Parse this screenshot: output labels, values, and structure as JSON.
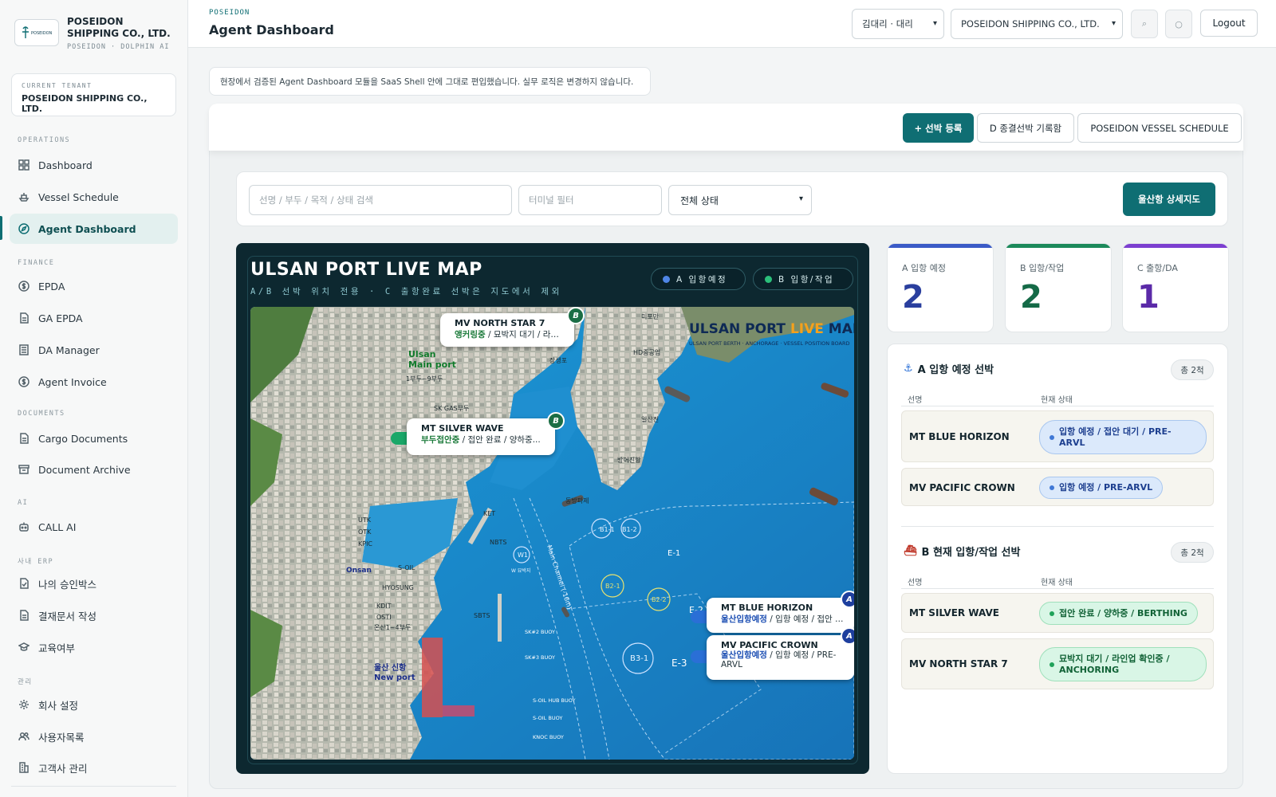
{
  "brand": {
    "name": "POSEIDON SHIPPING CO., LTD.",
    "sub": "POSEIDON · DOLPHIN AI",
    "logo_text": "POSEIDON"
  },
  "tenant": {
    "label": "CURRENT TENANT",
    "name": "POSEIDON SHIPPING CO., LTD."
  },
  "nav": {
    "operations_label": "OPERATIONS",
    "finance_label": "FINANCE",
    "documents_label": "DOCUMENTS",
    "ai_label": "AI",
    "erp_label": "사내 ERP",
    "admin_label": "관리",
    "items": [
      {
        "label": "Dashboard",
        "icon": "grid-icon"
      },
      {
        "label": "Vessel Schedule",
        "icon": "ship-icon"
      },
      {
        "label": "Agent Dashboard",
        "icon": "compass-icon",
        "active": true
      },
      {
        "label": "EPDA",
        "icon": "dollar-icon"
      },
      {
        "label": "GA EPDA",
        "icon": "document-icon"
      },
      {
        "label": "DA Manager",
        "icon": "document-list-icon"
      },
      {
        "label": "Agent Invoice",
        "icon": "dollar-icon"
      },
      {
        "label": "Cargo Documents",
        "icon": "document-icon"
      },
      {
        "label": "Document Archive",
        "icon": "archive-icon"
      },
      {
        "label": "CALL AI",
        "icon": "robot-icon"
      },
      {
        "label": "나의 승인박스",
        "icon": "check-document-icon"
      },
      {
        "label": "결재문서 작성",
        "icon": "document-icon"
      },
      {
        "label": "교육여부",
        "icon": "graduation-cap-icon"
      },
      {
        "label": "회사 설정",
        "icon": "gear-icon"
      },
      {
        "label": "사용자목록",
        "icon": "users-icon"
      },
      {
        "label": "고객사 관리",
        "icon": "building-icon"
      }
    ]
  },
  "header": {
    "crumb": "POSEIDON",
    "title": "Agent Dashboard",
    "user_select": "김대리 · 대리",
    "company_select": "POSEIDON SHIPPING CO., LTD.",
    "search_icon_glyph": "⌕",
    "user_icon_glyph": "○",
    "logout": "Logout"
  },
  "notice": "현장에서 검증된 Agent Dashboard 모듈을 SaaS Shell 안에 그대로 편입했습니다. 실무 로직은 변경하지 않습니다.",
  "toolbar": {
    "add_vessel": "+ 선박 등록",
    "closed_records": "D 종결선박 기록함",
    "schedule": "POSEIDON VESSEL SCHEDULE"
  },
  "filters": {
    "search_placeholder": "선명 / 부두 / 목적 / 상태 검색",
    "terminal_placeholder": "터미널 필터",
    "status_select": "전체 상태",
    "detail_map": "울산항 상세지도"
  },
  "map": {
    "title": "ULSAN PORT LIVE MAP",
    "subtitle": "A/B 선박 위치 전용 · C 출항완료 선박은 지도에서 제외",
    "legend_a": "A 입항예정",
    "legend_b": "B 입항/작업",
    "board_title_a": "ULSAN PORT ",
    "board_title_b": "LIVE",
    "board_title_c": " MAP",
    "board_sub": "ULSAN PORT BERTH · ANCHORAGE · VESSEL POSITION BOARD",
    "colors": {
      "a": "#4f86e6",
      "b": "#2bbf7a",
      "sea": "#1f8fd0"
    },
    "labels": {
      "ulsan_main": "Ulsan\nMain port",
      "main_berth": "1부두~9부두",
      "new_port": "울산 신항\nNew port",
      "onsan": "Onsan",
      "channel": "Main Channel (-16m)",
      "anch_b11": "B1-1",
      "anch_b12": "B1-2",
      "anch_b21": "B2-1",
      "anch_b22": "B2-2",
      "anch_b31": "B3-1",
      "zone_e1": "E-1",
      "zone_e2": "E-2",
      "zone_e3": "E-3",
      "w1": "W1",
      "w_sub": "W 묘박지",
      "sk2": "SK#2 BUOY",
      "sk3": "SK#3 BUOY",
      "hub": "S-OIL HUB BUOY",
      "soil_buoy": "S-OIL BUOY",
      "knoc": "KNOC BUOY",
      "hd": "HD중공업",
      "mipo": "미포만",
      "sk_gas": "SK GAS부두",
      "ilsan": "일산진",
      "bang": "방어진항",
      "dong": "동방파제",
      "jang": "장생포",
      "utk": "UTK",
      "otk": "OTK",
      "kpic": "KPIC",
      "hyosung": "HYOSUNG",
      "soil": "S-OIL",
      "kdit": "KDIT",
      "osti": "OSTI",
      "onsan_berth": "온산1~4부두",
      "sbts": "SBTS",
      "ket": "KET",
      "nbts": "NBTS"
    }
  },
  "vessels_on_map": [
    {
      "name": "MV NORTH STAR 7",
      "status_bold": "앵커링중",
      "status_rest": " / 묘박지 대기 / 라인업...",
      "badge": "B"
    },
    {
      "name": "MT SILVER WAVE",
      "status_bold": "부두접안중",
      "status_rest": " / 접안 완료 / 양하중...",
      "badge": "B"
    },
    {
      "name": "MT BLUE HORIZON",
      "status_bold": "울산입항예정",
      "status_rest": " / 입항 예정 / 접안 대기 / PRE-ARVL",
      "badge": "A"
    },
    {
      "name": "MV PACIFIC CROWN",
      "status_bold": "울산입항예정",
      "status_rest": " / 입항 예정 / PRE-ARVL",
      "badge": "A"
    }
  ],
  "kpis": [
    {
      "label": "A 입항 예정",
      "value": "2",
      "color": "#2a3f9e",
      "bar": "#3b5bc7"
    },
    {
      "label": "B 입항/작업",
      "value": "2",
      "color": "#146a47",
      "bar": "#1c8a5b"
    },
    {
      "label": "C 출항/DA",
      "value": "1",
      "color": "#5b2aa8",
      "bar": "#7c3fd0"
    }
  ],
  "section_a": {
    "title": "A 입항 예정 선박",
    "count": "총 2척",
    "col_name": "선명",
    "col_status": "현재 상태",
    "rows": [
      {
        "name": "MT BLUE HORIZON",
        "status": "입항 예정 / 접안 대기 / PRE-\nARVL"
      },
      {
        "name": "MV PACIFIC CROWN",
        "status": "입항 예정 / PRE-ARVL"
      }
    ]
  },
  "section_b": {
    "title": "B 현재 입항/작업 선박",
    "count": "총 2척",
    "col_name": "선명",
    "col_status": "현재 상태",
    "rows": [
      {
        "name": "MT SILVER WAVE",
        "status": "접안 완료 / 양하중 / BERTHING"
      },
      {
        "name": "MV NORTH STAR 7",
        "status": "묘박지 대기 / 라인업 확인중 /\nANCHORING"
      }
    ]
  }
}
